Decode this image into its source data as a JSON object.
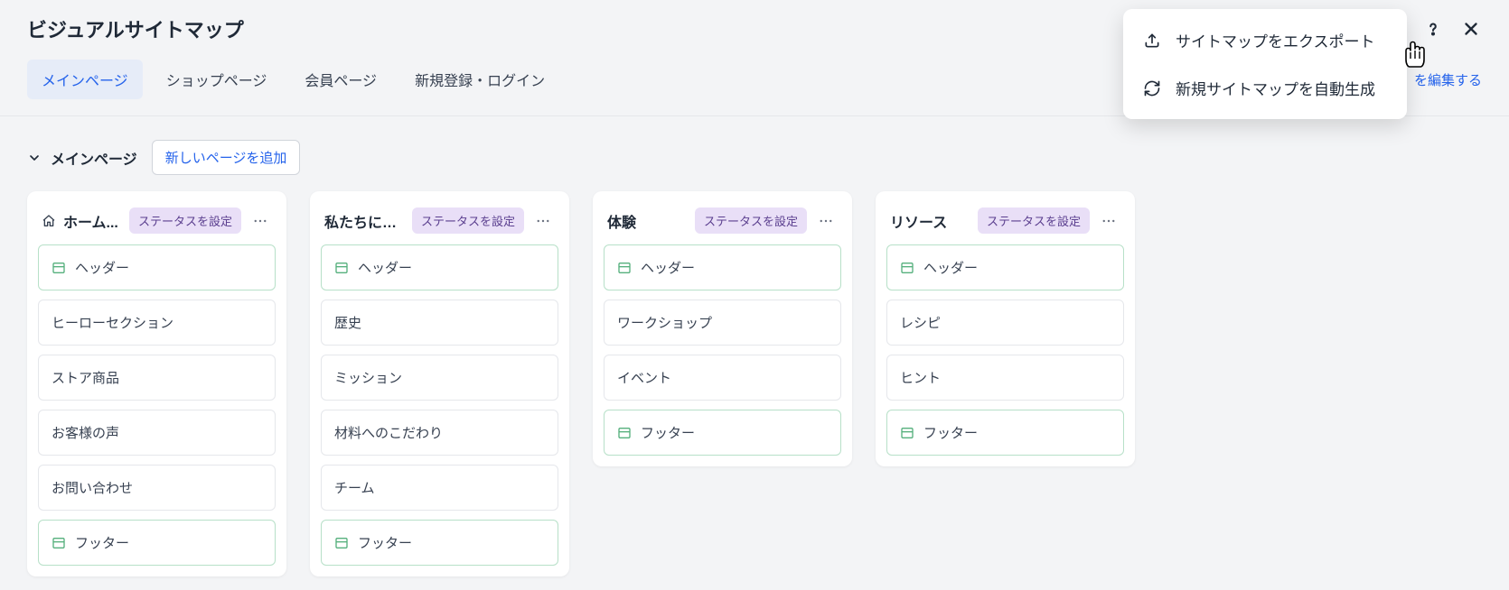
{
  "header": {
    "title": "ビジュアルサイトマップ"
  },
  "tabs": [
    {
      "label": "メインページ",
      "active": true
    },
    {
      "label": "ショップページ",
      "active": false
    },
    {
      "label": "会員ページ",
      "active": false
    },
    {
      "label": "新規登録・ログイン",
      "active": false
    }
  ],
  "edit_link": "を編集する",
  "section": {
    "title": "メインページ",
    "add_page_label": "新しいページを追加"
  },
  "status_badge_label": "ステータスを設定",
  "cards": [
    {
      "title": "ホーム...",
      "has_home_icon": true,
      "items": [
        {
          "label": "ヘッダー",
          "hf": true
        },
        {
          "label": "ヒーローセクション",
          "hf": false
        },
        {
          "label": "ストア商品",
          "hf": false
        },
        {
          "label": "お客様の声",
          "hf": false
        },
        {
          "label": "お問い合わせ",
          "hf": false
        },
        {
          "label": "フッター",
          "hf": true
        }
      ]
    },
    {
      "title": "私たちにつ...",
      "has_home_icon": false,
      "items": [
        {
          "label": "ヘッダー",
          "hf": true
        },
        {
          "label": "歴史",
          "hf": false
        },
        {
          "label": "ミッション",
          "hf": false
        },
        {
          "label": "材料へのこだわり",
          "hf": false
        },
        {
          "label": "チーム",
          "hf": false
        },
        {
          "label": "フッター",
          "hf": true
        }
      ]
    },
    {
      "title": "体験",
      "has_home_icon": false,
      "items": [
        {
          "label": "ヘッダー",
          "hf": true
        },
        {
          "label": "ワークショップ",
          "hf": false
        },
        {
          "label": "イベント",
          "hf": false
        },
        {
          "label": "フッター",
          "hf": true
        }
      ]
    },
    {
      "title": "リソース",
      "has_home_icon": false,
      "items": [
        {
          "label": "ヘッダー",
          "hf": true
        },
        {
          "label": "レシピ",
          "hf": false
        },
        {
          "label": "ヒント",
          "hf": false
        },
        {
          "label": "フッター",
          "hf": true
        }
      ]
    }
  ],
  "dropdown": {
    "items": [
      {
        "icon": "export",
        "label": "サイトマップをエクスポート"
      },
      {
        "icon": "refresh",
        "label": "新規サイトマップを自動生成"
      }
    ]
  },
  "colors": {
    "bg": "#f3f4f6",
    "accent": "#2563eb",
    "badge_bg": "#e9dff7",
    "badge_text": "#5b3f8f",
    "hf_border": "#b7e0c8"
  }
}
